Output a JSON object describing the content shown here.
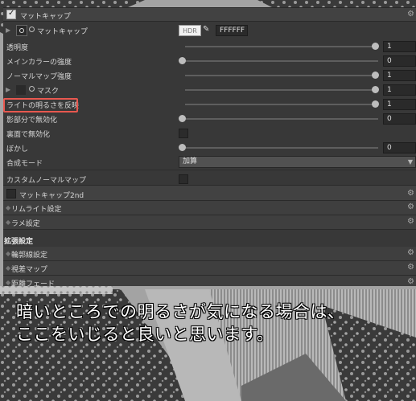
{
  "panel": {
    "header": {
      "title": "マットキャップ",
      "checked": true
    },
    "matcap_row": {
      "label": "マットキャップ",
      "hdr_label": "HDR",
      "color_hex": "FFFFFF",
      "color": "#ffffff"
    },
    "props": [
      {
        "label": "透明度",
        "value": "1",
        "level": 1
      },
      {
        "label": "メインカラーの強度",
        "value": "0",
        "level": 0
      },
      {
        "label": "ノーマルマップ強度",
        "value": "1",
        "level": 1
      },
      {
        "label": "マスク",
        "value": "1",
        "level": 1
      },
      {
        "label": "ライトの明るさを反映",
        "value": "1",
        "level": 1
      },
      {
        "label": "影部分で無効化",
        "value": "0",
        "level": 0
      },
      {
        "label": "裏面で無効化"
      },
      {
        "label": "ぼかし",
        "value": "0",
        "level": 0
      },
      {
        "label": "合成モード",
        "option": "加算"
      },
      {
        "label": "カスタムノーマルマップ"
      }
    ],
    "matcap2nd": {
      "title": "マットキャップ2nd"
    },
    "collapsed": [
      {
        "title": "リムライト設定"
      },
      {
        "title": "ラメ設定"
      }
    ],
    "extended": {
      "title": "拡張設定",
      "items": [
        {
          "title": "輪郭線設定"
        },
        {
          "title": "視差マップ"
        },
        {
          "title": "距離フェード"
        }
      ]
    }
  },
  "caption": {
    "line1": "暗いところでの明るさが気になる場合は、",
    "line2": "ここをいじると良いと思います。"
  },
  "colors": {
    "highlight": "#e8584f",
    "panel": "#383838"
  }
}
